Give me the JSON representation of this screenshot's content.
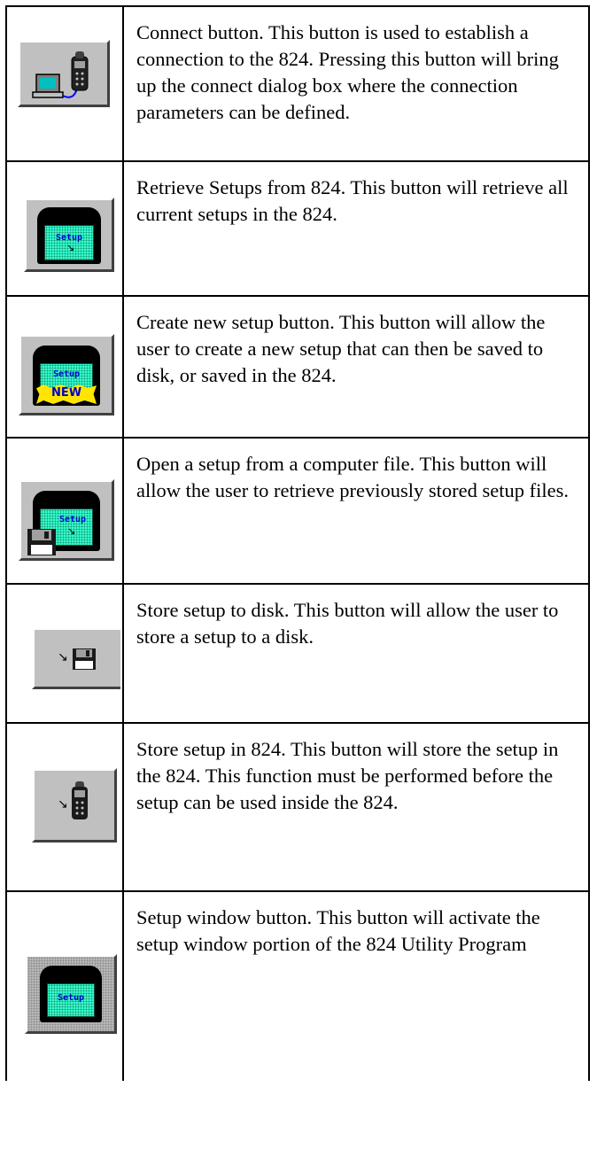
{
  "rows": [
    {
      "icon": "connect-icon",
      "description": "Connect button. This button is used to establish a connection to the 824. Pressing this button will bring up the connect dialog box where the connection parameters can be defined."
    },
    {
      "icon": "retrieve-setups-icon",
      "description": "Retrieve Setups from 824. This button will retrieve all current setups in the 824."
    },
    {
      "icon": "new-setup-icon",
      "description": "Create new setup button. This button will allow the user to create a new setup that can then be saved to disk, or saved in the 824."
    },
    {
      "icon": "open-setup-file-icon",
      "description": "Open a setup from a computer file. This button will allow the user to retrieve previously stored setup files."
    },
    {
      "icon": "store-to-disk-icon",
      "description": "Store setup to disk. This button will allow the user to store a setup to a disk."
    },
    {
      "icon": "store-in-824-icon",
      "description": "Store setup in 824. This button will store the setup in the 824. This function must be performed before the setup can be used inside the 824."
    },
    {
      "icon": "setup-window-icon",
      "description": "Setup window button. This button will activate the setup window portion of the 824 Utility Program"
    }
  ],
  "icon_text": {
    "setup": "Setup",
    "new": "NEW"
  }
}
